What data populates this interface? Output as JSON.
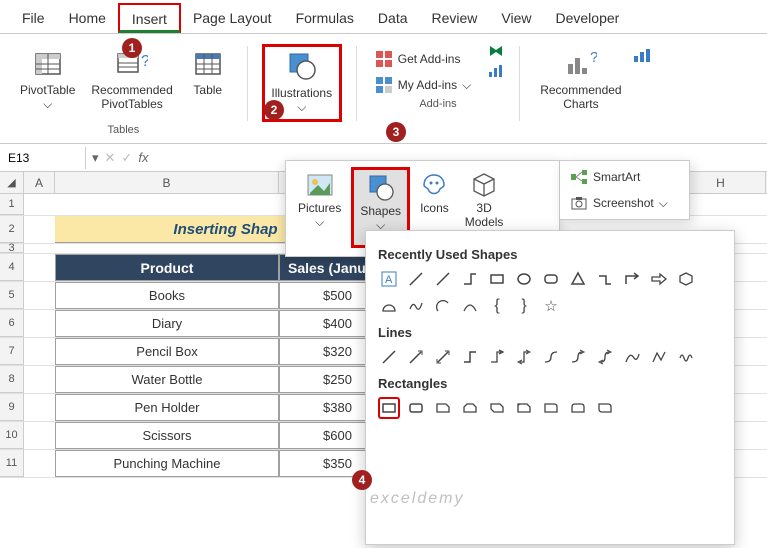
{
  "tabs": [
    "File",
    "Home",
    "Insert",
    "Page Layout",
    "Formulas",
    "Data",
    "Review",
    "View",
    "Developer"
  ],
  "ribbon": {
    "pivottable": "PivotTable",
    "recpivot": "Recommended\nPivotTables",
    "table": "Table",
    "illustrations": "Illustrations",
    "tables_group": "Tables",
    "addins_group": "Add-ins",
    "get_addins": "Get Add-ins",
    "my_addins": "My Add-ins",
    "rec_charts": "Recommended\nCharts"
  },
  "namebox": "E13",
  "ill_dropdown": {
    "pictures": "Pictures",
    "shapes": "Shapes",
    "icons": "Icons",
    "models": "3D\nModels",
    "smartart": "SmartArt",
    "screenshot": "Screenshot"
  },
  "shapes_gallery": {
    "recent": "Recently Used Shapes",
    "lines": "Lines",
    "rectangles": "Rectangles"
  },
  "sheet": {
    "title": "Inserting Shap",
    "headers": [
      "Product",
      "Sales (Janua"
    ],
    "rows": [
      {
        "p": "Books",
        "s": "$500"
      },
      {
        "p": "Diary",
        "s": "$400"
      },
      {
        "p": "Pencil Box",
        "s": "$320"
      },
      {
        "p": "Water Bottle",
        "s": "$250"
      },
      {
        "p": "Pen Holder",
        "s": "$380"
      },
      {
        "p": "Scissors",
        "s": "$600"
      },
      {
        "p": "Punching Machine",
        "s": "$350"
      }
    ]
  },
  "cols": [
    "A",
    "B",
    "H"
  ],
  "watermark": "exceldemy"
}
